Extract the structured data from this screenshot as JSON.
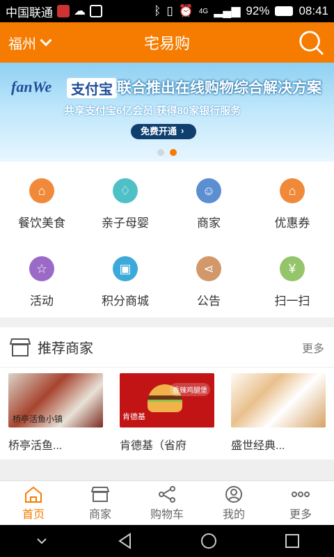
{
  "status": {
    "carrier": "中国联通",
    "network": "4G",
    "battery": "92%",
    "time": "08:41"
  },
  "header": {
    "city": "福州",
    "title": "宅易购"
  },
  "banner": {
    "brand1": "fanWe",
    "brand2": "支付宝",
    "headline": "联合推出在线购物综合解决方案",
    "subline": "共享支付宝6亿会员   获得80家银行服务",
    "cta": "免费开通"
  },
  "categories": [
    {
      "label": "餐饮美食",
      "color": "#f08a3a",
      "icon": "tag-icon"
    },
    {
      "label": "亲子母婴",
      "color": "#4fc1c6",
      "icon": "bottle-icon"
    },
    {
      "label": "商家",
      "color": "#5b8fd1",
      "icon": "user-icon"
    },
    {
      "label": "优惠券",
      "color": "#f08a3a",
      "icon": "coupon-icon"
    },
    {
      "label": "活动",
      "color": "#9b6ac7",
      "icon": "star-user-icon"
    },
    {
      "label": "积分商城",
      "color": "#3ba9d9",
      "icon": "gift-icon"
    },
    {
      "label": "公告",
      "color": "#d2986a",
      "icon": "share-icon"
    },
    {
      "label": "扫一扫",
      "color": "#94c56a",
      "icon": "scan-icon"
    }
  ],
  "recommend": {
    "title": "推荐商家",
    "more": "更多",
    "items": [
      {
        "name": "桥亭活鱼...",
        "img_caption": "桥亭活鱼小镇"
      },
      {
        "name": "肯德基（省府",
        "img_caption": "肯德基",
        "img_tag": "香辣鸡腿堡"
      },
      {
        "name": "盛世经典..."
      }
    ]
  },
  "tabs": [
    {
      "label": "首页",
      "icon": "home-icon"
    },
    {
      "label": "商家",
      "icon": "store-icon"
    },
    {
      "label": "购物车",
      "icon": "share-icon"
    },
    {
      "label": "我的",
      "icon": "profile-icon"
    },
    {
      "label": "更多",
      "icon": "more-icon"
    }
  ],
  "active_tab": 0
}
